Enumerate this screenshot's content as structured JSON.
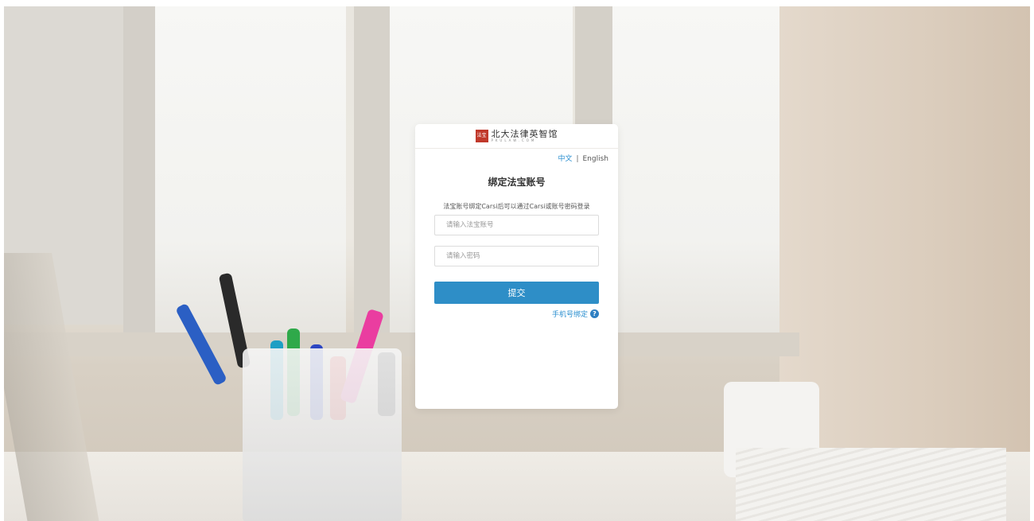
{
  "logo": {
    "seal_text": "法宝",
    "title": "北大法律英智馆",
    "subtitle": "PKULAW.COM"
  },
  "lang": {
    "zh": "中文",
    "separator": "|",
    "en": "English"
  },
  "form": {
    "title": "绑定法宝账号",
    "description": "法宝账号绑定Carsi后可以通过Carsi或账号密码登录",
    "account_placeholder": "请输入法宝账号",
    "password_placeholder": "请输入密码",
    "submit_label": "提交",
    "phone_bind_label": "手机号绑定",
    "help_icon": "?"
  },
  "colors": {
    "primary": "#2e8ec7",
    "link": "#2a8fd0",
    "seal": "#c0392b"
  }
}
